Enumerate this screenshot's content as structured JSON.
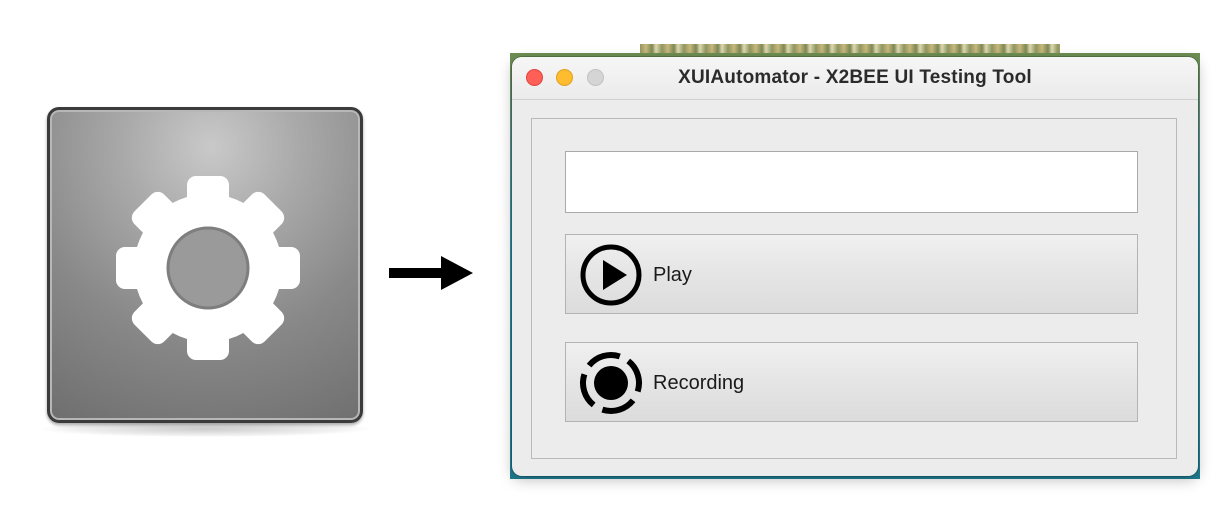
{
  "window": {
    "title": "XUIAutomator - X2BEE UI Testing Tool"
  },
  "input": {
    "value": "",
    "placeholder": ""
  },
  "buttons": {
    "play_label": "Play",
    "recording_label": "Recording"
  },
  "icons": {
    "app": "gear-icon",
    "arrow": "arrow-right-icon",
    "play": "play-circle-icon",
    "record": "record-icon"
  },
  "colors": {
    "close": "#fe5f57",
    "minimize": "#febc2e",
    "zoom": "#d5d5d5"
  }
}
